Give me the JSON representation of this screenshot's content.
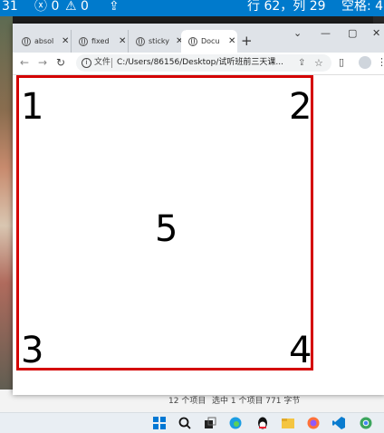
{
  "statusbar": {
    "left_partial": "31",
    "errors": "0",
    "warnings": "0",
    "cursor_position": "行 62，列 29",
    "indent": "空格: 4"
  },
  "browser": {
    "tabs": [
      {
        "title": "absol",
        "active": false
      },
      {
        "title": "fixed",
        "active": false
      },
      {
        "title": "sticky",
        "active": false
      },
      {
        "title": "Docu",
        "active": true
      }
    ],
    "address": {
      "protocol_label": "文件",
      "url": "C:/Users/86156/Desktop/试听班前三天课..."
    }
  },
  "page": {
    "border_color": "#d40000",
    "corners": {
      "top_left": "1",
      "top_right": "2",
      "center": "5",
      "bottom_left": "3",
      "bottom_right": "4"
    }
  },
  "explorer_status": {
    "item_count": "12 个项目",
    "selection": "选中 1 个项目 771 字节"
  },
  "taskbar": {
    "icons": [
      "windows-start-icon",
      "search-icon",
      "task-view-icon",
      "edge-icon",
      "qq-icon",
      "file-explorer-icon",
      "firefox-icon",
      "vscode-icon",
      "chrome-icon"
    ]
  }
}
